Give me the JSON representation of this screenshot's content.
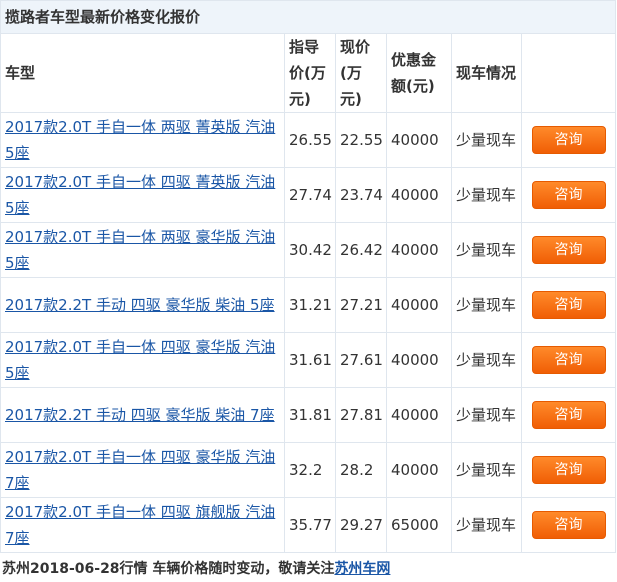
{
  "title": "揽路者车型最新价格变化报价",
  "headers": {
    "model": "车型",
    "guide_price": "指导价(万元)",
    "current_price": "现价(万元)",
    "discount": "优惠金额(元)",
    "stock": "现车情况",
    "action": ""
  },
  "rows": [
    {
      "model": "2017款2.0T 手自一体 两驱 菁英版 汽油 5座",
      "guide": "26.55",
      "current": "22.55",
      "discount": "40000",
      "stock": "少量现车",
      "button": "咨询"
    },
    {
      "model": "2017款2.0T 手自一体 四驱 菁英版 汽油 5座",
      "guide": "27.74",
      "current": "23.74",
      "discount": "40000",
      "stock": "少量现车",
      "button": "咨询"
    },
    {
      "model": "2017款2.0T 手自一体 两驱 豪华版 汽油 5座",
      "guide": "30.42",
      "current": "26.42",
      "discount": "40000",
      "stock": "少量现车",
      "button": "咨询"
    },
    {
      "model": "2017款2.2T 手动 四驱 豪华版 柴油 5座",
      "guide": "31.21",
      "current": "27.21",
      "discount": "40000",
      "stock": "少量现车",
      "button": "咨询"
    },
    {
      "model": "2017款2.0T 手自一体 四驱 豪华版 汽油 5座",
      "guide": "31.61",
      "current": "27.61",
      "discount": "40000",
      "stock": "少量现车",
      "button": "咨询"
    },
    {
      "model": "2017款2.2T 手动 四驱 豪华版 柴油 7座",
      "guide": "31.81",
      "current": "27.81",
      "discount": "40000",
      "stock": "少量现车",
      "button": "咨询"
    },
    {
      "model": "2017款2.0T 手自一体 四驱 豪华版 汽油 7座",
      "guide": "32.2",
      "current": "28.2",
      "discount": "40000",
      "stock": "少量现车",
      "button": "咨询"
    },
    {
      "model": "2017款2.0T 手自一体 四驱 旗舰版 汽油 7座",
      "guide": "35.77",
      "current": "29.27",
      "discount": "65000",
      "stock": "少量现车",
      "button": "咨询"
    }
  ],
  "footer": {
    "text": "苏州2018-06-28行情 车辆价格随时变动，敬请关注",
    "link": "苏州车网"
  },
  "colors": {
    "link": "#1a56a6",
    "button": "#f05e05",
    "title_bg": "#eef4fa",
    "border": "#dfe6ee"
  }
}
